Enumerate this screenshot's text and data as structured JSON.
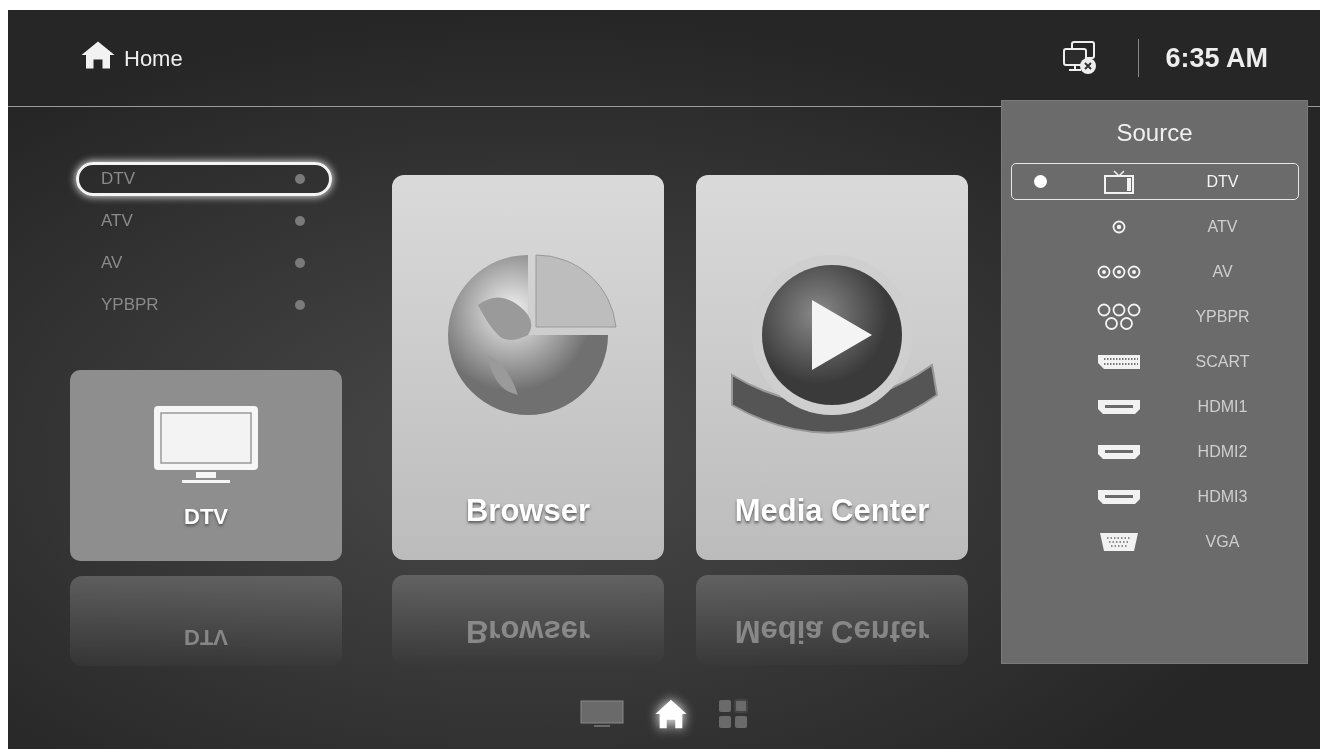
{
  "header": {
    "title": "Home",
    "time": "6:35 AM"
  },
  "source_list": [
    {
      "label": "DTV",
      "selected": true
    },
    {
      "label": "ATV",
      "selected": false
    },
    {
      "label": "AV",
      "selected": false
    },
    {
      "label": "YPBPR",
      "selected": false
    }
  ],
  "tiles": [
    {
      "kind": "tv",
      "label": "DTV",
      "reflection": "DTV"
    },
    {
      "kind": "browser",
      "label": "Browser",
      "reflection": "Browser"
    },
    {
      "kind": "media",
      "label": "Media Center",
      "reflection": "Media Center"
    }
  ],
  "source_menu": {
    "title": "Source",
    "items": [
      {
        "kind": "tv",
        "label": "DTV",
        "selected": true
      },
      {
        "kind": "rca1",
        "label": "ATV",
        "selected": false
      },
      {
        "kind": "rca3",
        "label": "AV",
        "selected": false
      },
      {
        "kind": "ypbpr",
        "label": "YPBPR",
        "selected": false
      },
      {
        "kind": "scart",
        "label": "SCART",
        "selected": false
      },
      {
        "kind": "hdmi",
        "label": "HDMI1",
        "selected": false
      },
      {
        "kind": "hdmi",
        "label": "HDMI2",
        "selected": false
      },
      {
        "kind": "hdmi",
        "label": "HDMI3",
        "selected": false
      },
      {
        "kind": "vga",
        "label": "VGA",
        "selected": false
      }
    ]
  },
  "bottom_nav": [
    {
      "kind": "tv",
      "selected": false
    },
    {
      "kind": "home",
      "selected": true
    },
    {
      "kind": "apps",
      "selected": false
    }
  ]
}
